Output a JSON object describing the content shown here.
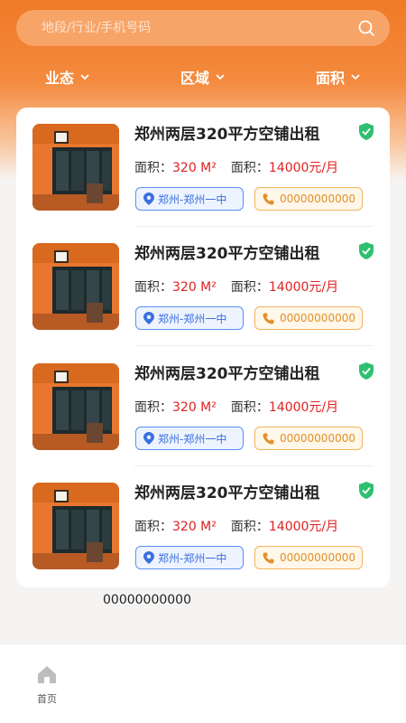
{
  "search": {
    "placeholder": "地段/行业/手机号码"
  },
  "filters": [
    {
      "label": "业态"
    },
    {
      "label": "区域"
    },
    {
      "label": "面积"
    }
  ],
  "listings": [
    {
      "title": "郑州两层320平方空铺出租",
      "area_label": "面积：",
      "area_value": "320 M²",
      "price_label": "面积：",
      "price_value": "14000元/月",
      "location": "郑州-郑州一中",
      "phone": "00000000000"
    },
    {
      "title": "郑州两层320平方空铺出租",
      "area_label": "面积：",
      "area_value": "320 M²",
      "price_label": "面积：",
      "price_value": "14000元/月",
      "location": "郑州-郑州一中",
      "phone": "00000000000"
    },
    {
      "title": "郑州两层320平方空铺出租",
      "area_label": "面积：",
      "area_value": "320 M²",
      "price_label": "面积：",
      "price_value": "14000元/月",
      "location": "郑州-郑州一中",
      "phone": "00000000000"
    },
    {
      "title": "郑州两层320平方空铺出租",
      "area_label": "面积：",
      "area_value": "320 M²",
      "price_label": "面积：",
      "price_value": "14000元/月",
      "location": "郑州-郑州一中",
      "phone": "00000000000"
    }
  ],
  "footer_text": "00000000000",
  "tabbar": {
    "home_label": "首页"
  },
  "colors": {
    "accent": "#f07a26",
    "price_red": "#e02020",
    "location_blue": "#3a6fe0",
    "phone_orange": "#e0912a",
    "verified_green": "#2fbf71"
  },
  "icons": {
    "search": "search-icon",
    "chevron": "chevron-down-icon",
    "verified": "shield-check-icon",
    "location": "location-pin-icon",
    "phone": "phone-icon",
    "home": "home-icon"
  }
}
